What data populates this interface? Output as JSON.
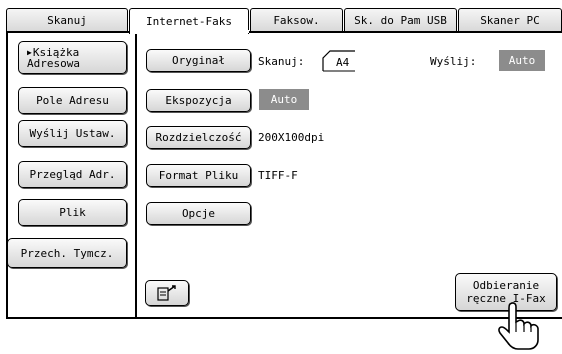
{
  "tabs": [
    {
      "label": "Skanuj"
    },
    {
      "label": "Internet-Faks"
    },
    {
      "label": "Faksow."
    },
    {
      "label": "Sk. do Pam USB"
    },
    {
      "label": "Skaner PC"
    }
  ],
  "sidebar": {
    "address_book_line1": "Książka",
    "address_book_line2": "Adresowa",
    "address_field": "Pole Adresu",
    "send_settings": "Wyślij Ustaw.",
    "address_review": "Przegląd Adr.",
    "file": "Plik",
    "quick_file": "Przech. Tymcz."
  },
  "settings": {
    "original_button": "Oryginał",
    "scan_label": "Skanuj:",
    "paper_size": "A4",
    "send_label": "Wyślij:",
    "send_value": "Auto",
    "exposure_button": "Ekspozycja",
    "exposure_value": "Auto",
    "resolution_button": "Rozdzielczość",
    "resolution_value": "200X100dpi",
    "file_format_button": "Format Pliku",
    "file_format_value": "TIFF-F",
    "options_button": "Opcje"
  },
  "bottom": {
    "manual_reception_line1": "Odbieranie",
    "manual_reception_line2": "ręczne I-Fax"
  },
  "icons": {
    "address_book_arrow": "triangle-right-icon",
    "program_icon": "program-icon",
    "hand_pointer": "hand-pointer-icon"
  }
}
